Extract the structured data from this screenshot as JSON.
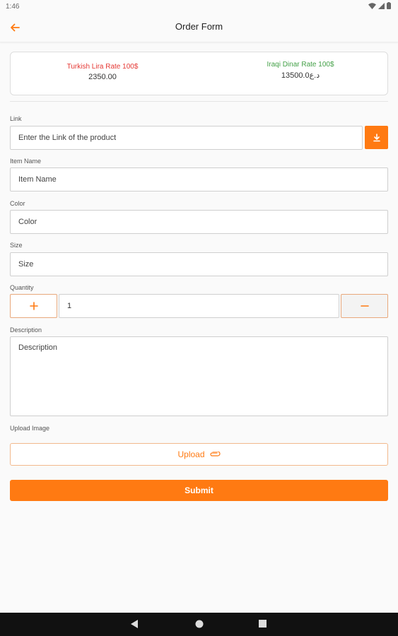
{
  "status_bar": {
    "time": "1:46"
  },
  "app_bar": {
    "title": "Order Form",
    "back_icon": "arrow-left-icon"
  },
  "rates": {
    "turkish": {
      "label": "Turkish Lira Rate 100$",
      "value": "2350.00",
      "color": "#e53935"
    },
    "iraqi": {
      "label": "Iraqi Dinar Rate 100$",
      "value": "13500.0د.ع",
      "color": "#43a047"
    }
  },
  "form": {
    "link": {
      "label": "Link",
      "placeholder": "Enter the Link of the product"
    },
    "item_name": {
      "label": "Item Name",
      "placeholder": "Item Name"
    },
    "color": {
      "label": "Color",
      "placeholder": "Color"
    },
    "size": {
      "label": "Size",
      "placeholder": "Size"
    },
    "quantity": {
      "label": "Quantity",
      "value": "1",
      "plus": "+",
      "minus": "−"
    },
    "description": {
      "label": "Description",
      "placeholder": "Description"
    },
    "upload": {
      "label": "Upload Image",
      "button": "Upload"
    },
    "submit": "Submit"
  },
  "colors": {
    "accent": "#ff7a12"
  }
}
